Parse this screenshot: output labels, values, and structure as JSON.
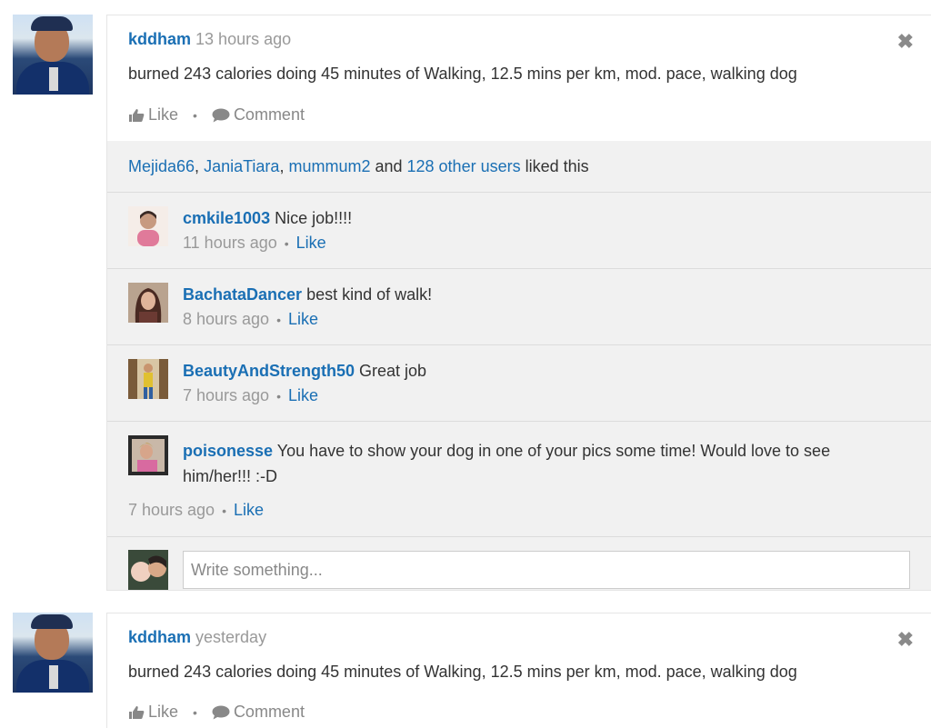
{
  "posts": [
    {
      "user": "kddham",
      "time": "13 hours ago",
      "text": "burned 243 calories doing 45 minutes of Walking, 12.5 mins per km, mod. pace, walking dog",
      "like_label": "Like",
      "comment_label": "Comment",
      "close_icon": "close-icon",
      "likes": {
        "names": [
          "Mejida66",
          "JaniaTiara",
          "mummum2"
        ],
        "sep1": ", ",
        "sep2": ", ",
        "and": " and ",
        "others": "128 other users",
        "suffix": " liked this"
      },
      "comments": [
        {
          "user": "cmkile1003",
          "text": " Nice job!!!!",
          "time": "11 hours ago",
          "like": "Like"
        },
        {
          "user": "BachataDancer",
          "text": " best kind of walk!",
          "time": "8 hours ago",
          "like": "Like"
        },
        {
          "user": "BeautyAndStrength50",
          "text": " Great job",
          "time": "7 hours ago",
          "like": "Like"
        },
        {
          "user": "poisonesse",
          "text": " You have to show your dog in one of your pics some time! Would love to see",
          "text2": "him/her!!! :-D",
          "time": "7 hours ago",
          "like": "Like"
        }
      ],
      "write_placeholder": "Write something..."
    },
    {
      "user": "kddham",
      "time": "yesterday",
      "text": "burned 243 calories doing 45 minutes of Walking, 12.5 mins per km, mod. pace, walking dog",
      "like_label": "Like",
      "comment_label": "Comment"
    }
  ],
  "dot": "•"
}
